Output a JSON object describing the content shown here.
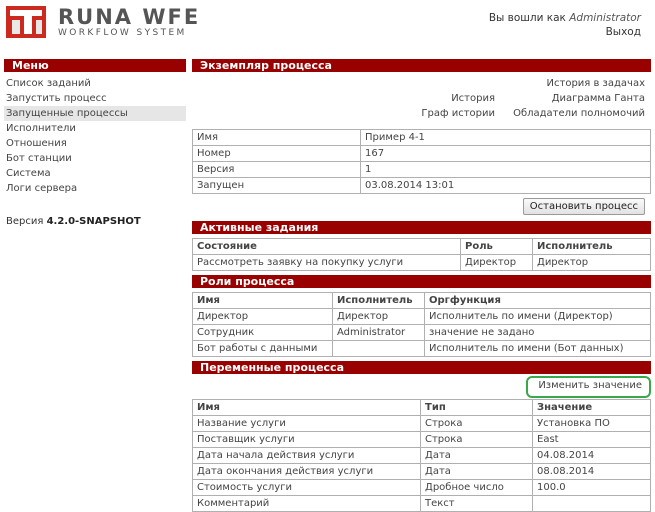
{
  "header": {
    "logo_title": "RUNA WFE",
    "logo_subtitle": "WORKFLOW SYSTEM",
    "logged_in_label": "Вы вошли как",
    "user_name": "Administrator",
    "logout": "Выход"
  },
  "sidebar": {
    "menu_title": "Меню",
    "items": [
      {
        "label": "Список заданий"
      },
      {
        "label": "Запустить процесс"
      },
      {
        "label": "Запущенные процессы"
      },
      {
        "label": "Исполнители"
      },
      {
        "label": "Отношения"
      },
      {
        "label": "Бот станции"
      },
      {
        "label": "Система"
      },
      {
        "label": "Логи сервера"
      }
    ],
    "active_item": "Запущенные процессы",
    "version_label": "Версия",
    "version_value": "4.2.0-SNAPSHOT"
  },
  "process": {
    "title": "Экземпляр процесса",
    "links": {
      "task_history": "История в задачах",
      "history": "История",
      "gantt": "Диаграмма Ганта",
      "history_graph": "Граф истории",
      "delegates": "Обладатели полномочий"
    },
    "props": [
      {
        "name": "Имя",
        "value": "Пример 4-1"
      },
      {
        "name": "Номер",
        "value": "167"
      },
      {
        "name": "Версия",
        "value": "1"
      },
      {
        "name": "Запущен",
        "value": "03.08.2014 13:01"
      }
    ],
    "stop_button": "Остановить процесс"
  },
  "active_tasks": {
    "title": "Активные задания",
    "headers": [
      "Состояние",
      "Роль",
      "Исполнитель"
    ],
    "rows": [
      [
        "Рассмотреть заявку на покупку услуги",
        "Директор",
        "Директор"
      ]
    ]
  },
  "roles": {
    "title": "Роли процесса",
    "headers": [
      "Имя",
      "Исполнитель",
      "Оргфункция"
    ],
    "rows": [
      [
        "Директор",
        "Директор",
        "Исполнитель по имени (Директор)"
      ],
      [
        "Сотрудник",
        "Administrator",
        "значение не задано"
      ],
      [
        "Бот работы с данными",
        "",
        "Исполнитель по имени (Бот данных)"
      ]
    ]
  },
  "variables": {
    "title": "Переменные процесса",
    "change_link": "Изменить значение",
    "headers": [
      "Имя",
      "Тип",
      "Значение"
    ],
    "rows": [
      [
        "Название услуги",
        "Строка",
        "Установка ПО"
      ],
      [
        "Поставщик услуги",
        "Строка",
        "East"
      ],
      [
        "Дата начала действия услуги",
        "Дата",
        "04.08.2014"
      ],
      [
        "Дата окончания действия услуги",
        "Дата",
        "08.08.2014"
      ],
      [
        "Стоимость услуги",
        "Дробное число",
        "100.0"
      ],
      [
        "Комментарий",
        "Текст",
        ""
      ]
    ]
  },
  "colors": {
    "section_bar": "#990000",
    "highlight_box": "#3aa84a",
    "active_menu_bg": "#e6e6e6"
  }
}
